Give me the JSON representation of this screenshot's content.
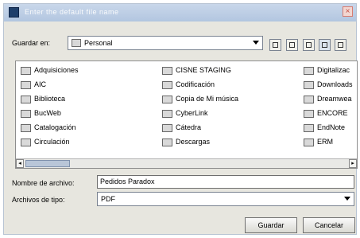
{
  "window": {
    "title": "Enter the default file name"
  },
  "lookin": {
    "label": "Guardar en:",
    "value": "Personal"
  },
  "toolbar": {
    "buttons": [
      "up-folder-icon",
      "home-icon",
      "new-folder-icon",
      "list-view-icon",
      "details-view-icon"
    ]
  },
  "files": {
    "col1": [
      "Adquisiciones",
      "AIC",
      "Biblioteca",
      "BucWeb",
      "Catalogación",
      "Circulación"
    ],
    "col2": [
      "CISNE STAGING",
      "Codificación",
      "Copia de Mi música",
      "CyberLink",
      "Cátedra",
      "Descargas"
    ],
    "col3": [
      "Digitalizac",
      "Downloads",
      "Dreamwea",
      "ENCORE",
      "EndNote",
      "ERM"
    ]
  },
  "filename": {
    "label": "Nombre de archivo:",
    "value": "Pedidos Paradox"
  },
  "filetype": {
    "label": "Archivos de tipo:",
    "value": "PDF"
  },
  "actions": {
    "save": "Guardar",
    "cancel": "Cancelar"
  }
}
